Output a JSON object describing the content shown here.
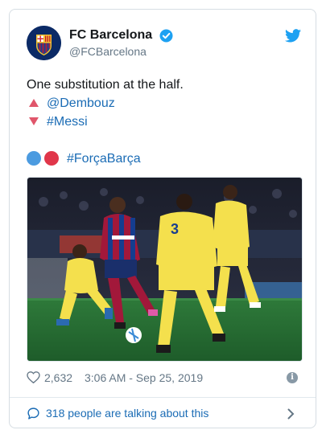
{
  "account": {
    "display_name": "FC Barcelona",
    "handle": "@FCBarcelona",
    "avatar": "fc-barcelona-crest",
    "verified": true
  },
  "tweet": {
    "line1": "One substitution at the half.",
    "sub_in": "@Dembouz",
    "sub_out": "#Messi",
    "hashtag": "#ForçaBarça",
    "photo": "Messi dribbling past Villarreal players",
    "likes": "2,632",
    "timestamp": "3:06 AM - Sep 25, 2019"
  },
  "footer": {
    "talking": "318 people are talking about this"
  },
  "colors": {
    "link": "#1b6cb5",
    "up_arrow": "#e0566b",
    "down_arrow": "#e0566b",
    "circle_blue": "#4c9be0",
    "circle_red": "#e0364a",
    "verified": "#1da1f2",
    "twitter": "#1da1f2"
  }
}
